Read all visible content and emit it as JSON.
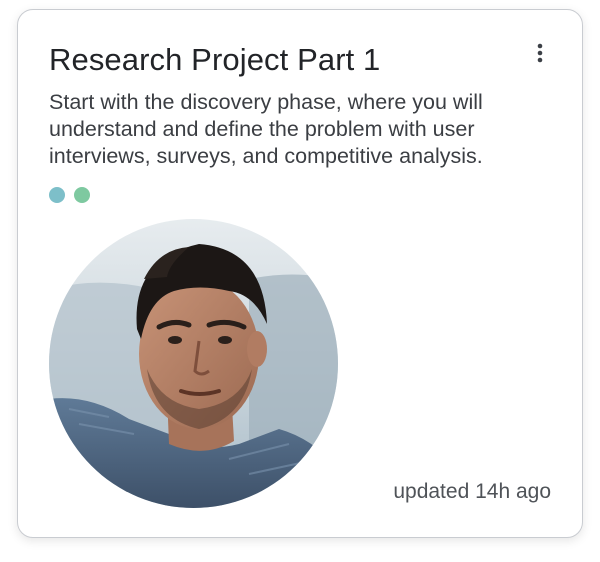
{
  "card": {
    "title": "Research Project Part 1",
    "description": "Start with the discovery phase, where you will understand and define the problem with user interviews, surveys, and competitive analysis.",
    "status_dots": [
      {
        "color": "#7dbfc9"
      },
      {
        "color": "#7ec9a0"
      }
    ],
    "avatar_icon": "person-photo",
    "menu_icon": "more-vertical-icon",
    "updated": "updated 14h ago"
  }
}
